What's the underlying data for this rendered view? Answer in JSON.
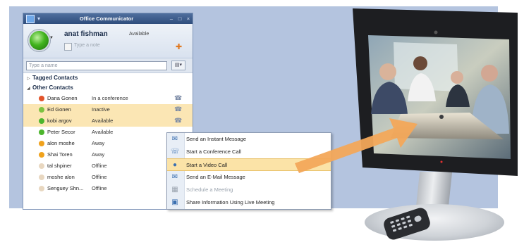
{
  "window": {
    "title": "Office Communicator",
    "controls": [
      "–",
      "□",
      "×"
    ]
  },
  "user": {
    "name": "anat fishman",
    "status": "Available",
    "note_placeholder": "Type a note"
  },
  "search": {
    "placeholder": "Type a name"
  },
  "groups": {
    "tagged": "Tagged Contacts",
    "other": "Other Contacts"
  },
  "contacts": [
    {
      "name": "Dana Gonen",
      "status": "In a conference",
      "color": "#e2532a",
      "highlight": false
    },
    {
      "name": "Ed Gonen",
      "status": "Inactive",
      "color": "#7cc240",
      "highlight": true
    },
    {
      "name": "kobi argov",
      "status": "Available",
      "color": "#4cb52c",
      "highlight": true
    },
    {
      "name": "Peter Secor",
      "status": "Available",
      "color": "#4cb52c",
      "highlight": false
    },
    {
      "name": "alon moshe",
      "status": "Away",
      "color": "#f0a21c",
      "highlight": false
    },
    {
      "name": "Shai Toren",
      "status": "Away",
      "color": "#f0a21c",
      "highlight": false
    },
    {
      "name": "tal shpiner",
      "status": "Offline",
      "color": "#e8d7c0",
      "highlight": false
    },
    {
      "name": "moshe alon",
      "status": "Offline",
      "color": "#e8d7c0",
      "highlight": false
    },
    {
      "name": "Senguey Shn...",
      "status": "Offline",
      "color": "#e8d7c0",
      "highlight": false
    }
  ],
  "menu": {
    "items": [
      {
        "label": "Send an Instant Message",
        "icon": "chat-icon",
        "glyph": "✉",
        "highlight": false,
        "disabled": false
      },
      {
        "label": "Start a Conference Call",
        "icon": "phone-icon",
        "glyph": "☏",
        "highlight": false,
        "disabled": false
      },
      {
        "label": "Start a Video Call",
        "icon": "webcam-icon",
        "glyph": "●",
        "highlight": true,
        "disabled": false
      },
      {
        "label": "Send an E-Mail Message",
        "icon": "email-icon",
        "glyph": "✉",
        "highlight": false,
        "disabled": false
      },
      {
        "label": "Schedule a Meeting",
        "icon": "calendar-icon",
        "glyph": "▦",
        "highlight": false,
        "disabled": true
      },
      {
        "label": "Share Information Using Live Meeting",
        "icon": "live-meeting-icon",
        "glyph": "▣",
        "highlight": false,
        "disabled": false
      }
    ]
  },
  "colors": {
    "backdrop": "#b4c4df",
    "highlight": "#fbe6b4",
    "arrow": "#f3a85a"
  }
}
